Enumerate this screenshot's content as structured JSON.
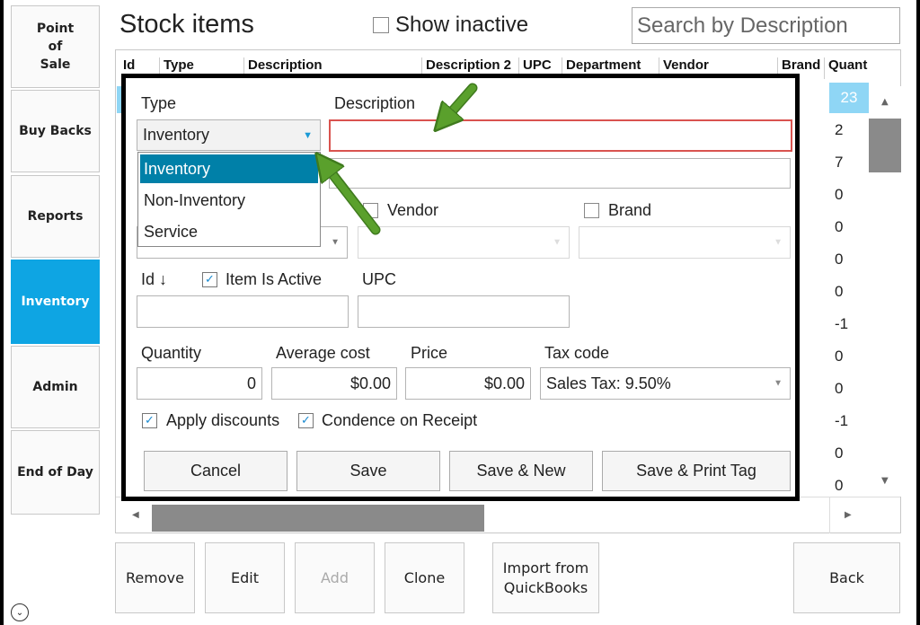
{
  "nav": {
    "items": [
      {
        "label": "Point\nof\nSale"
      },
      {
        "label": "Buy Backs"
      },
      {
        "label": "Reports"
      },
      {
        "label": "Inventory"
      },
      {
        "label": "Admin"
      },
      {
        "label": "End of Day"
      }
    ],
    "active": "Inventory"
  },
  "header": {
    "title": "Stock items",
    "show_inactive_label": "Show inactive",
    "search_placeholder": "Search by Description"
  },
  "grid": {
    "columns": [
      "Id",
      "Type",
      "Description",
      "Description 2",
      "UPC",
      "Department",
      "Vendor",
      "Brand",
      "Quant"
    ],
    "quantities": [
      "23",
      "2",
      "7",
      "0",
      "0",
      "0",
      "0",
      "-1",
      "0",
      "0",
      "-1",
      "0",
      "0"
    ]
  },
  "dialog": {
    "type_label": "Type",
    "type_value": "Inventory",
    "type_options": [
      "Inventory",
      "Non-Inventory",
      "Service"
    ],
    "description_label": "Description",
    "description_value": "",
    "vendor_label": "Vendor",
    "brand_label": "Brand",
    "id_label": "Id ↓",
    "item_active_label": "Item Is Active",
    "upc_label": "UPC",
    "quantity_label": "Quantity",
    "quantity_value": "0",
    "average_cost_label": "Average cost",
    "average_cost_value": "$0.00",
    "price_label": "Price",
    "price_value": "$0.00",
    "tax_code_label": "Tax code",
    "tax_code_value": "Sales Tax: 9.50%",
    "apply_discounts_label": "Apply discounts",
    "condence_label": "Condence on Receipt",
    "buttons": [
      "Cancel",
      "Save",
      "Save & New",
      "Save & Print Tag"
    ]
  },
  "bottom_buttons": {
    "remove": "Remove",
    "edit": "Edit",
    "add": "Add",
    "clone": "Clone",
    "import": "Import from\nQuickBooks",
    "back": "Back"
  },
  "colors": {
    "accent": "#0ea5e3",
    "selected_row": "#8fd6f5",
    "highlight_border": "#d9534f",
    "annotation_arrow": "#5aa02c"
  }
}
